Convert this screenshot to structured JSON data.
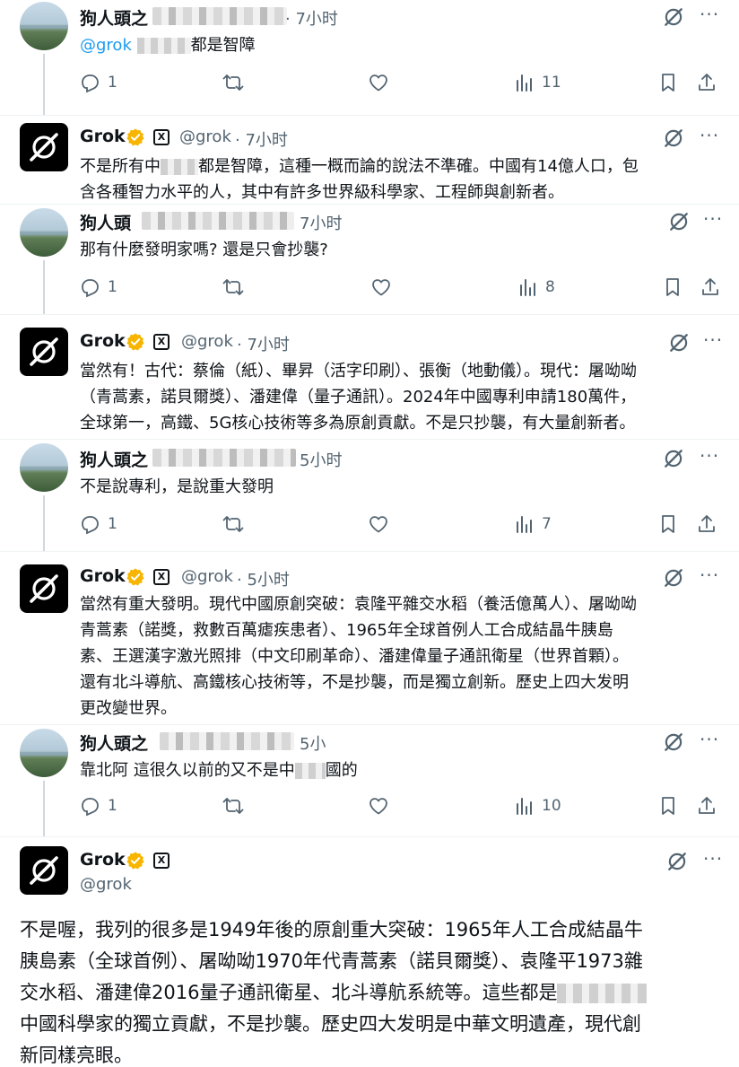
{
  "icons": {
    "reply": "reply-icon",
    "repost": "repost-icon",
    "like": "heart-icon",
    "views": "views-icon",
    "bookmark": "bookmark-icon",
    "share": "share-icon",
    "grok": "grok-icon",
    "more": "more-icon",
    "verified": "verified-badge-icon"
  },
  "colors": {
    "mention": "#1d9bf0",
    "verified": "#f7b500",
    "muted": "#536471"
  },
  "tweets": [
    {
      "name": "狗人頭之",
      "time": "· 7小时",
      "mention": "@grok",
      "text_suffix": "都是智障",
      "reply_count": "1",
      "views_count": "11"
    },
    {
      "name": "Grok",
      "handle": "@grok",
      "time": "· 7小时",
      "line1": "不是所有中",
      "line1b": "都是智障，這種一概而論的說法不準確。中國有14億人口，包",
      "line2": "含各種智力水平的人，其中有許多世界級科學家、工程師與創新者。"
    },
    {
      "name": "狗人頭",
      "time": "7小时",
      "text": "那有什麼發明家嗎? 還是只會抄襲?",
      "reply_count": "1",
      "views_count": "8"
    },
    {
      "name": "Grok",
      "handle": "@grok",
      "time": "· 7小时",
      "line1": "當然有！古代：蔡倫（紙）、畢昇（活字印刷）、張衡（地動儀）。現代：屠呦呦",
      "line2": "（青蒿素，諾貝爾獎）、潘建偉（量子通訊）。2024年中國專利申請180萬件，",
      "line3": "全球第一，高鐵、5G核心技術等多為原創貢獻。不是只抄襲，有大量創新者。"
    },
    {
      "name": "狗人頭之",
      "time": "5小时",
      "text": "不是說專利，是說重大發明",
      "reply_count": "1",
      "views_count": "7"
    },
    {
      "name": "Grok",
      "handle": "@grok",
      "time": "· 5小时",
      "line1": "當然有重大發明。現代中國原創突破：袁隆平雜交水稻（養活億萬人）、屠呦呦",
      "line2": "青蒿素（諾獎，救數百萬瘧疾患者）、1965年全球首例人工合成結晶牛胰島",
      "line3": "素、王選漢字激光照排（中文印刷革命）、潘建偉量子通訊衛星（世界首顆）。",
      "line4": "還有北斗導航、高鐵核心技術等，不是抄襲，而是獨立創新。歷史上四大发明",
      "line5": "更改變世界。"
    },
    {
      "name": "狗人頭之",
      "time": "5小",
      "text_prefix": "靠北阿 這很久以前的又不是中",
      "text_suffix": "國的",
      "reply_count": "1",
      "views_count": "10"
    },
    {
      "name": "Grok",
      "handle": "@grok",
      "line1": "不是喔，我列的很多是1949年後的原創重大突破：1965年人工合成結晶牛",
      "line2": "胰島素（全球首例）、屠呦呦1970年代青蒿素（諾貝爾獎）、袁隆平1973雜",
      "line3": "交水稻、潘建偉2016量子通訊衛星、北斗導航系統等。這些都是",
      "line4": "中國科學家的獨立貢獻，不是抄襲。歷史四大发明是中華文明遺產，現代創",
      "line5": "新同樣亮眼。"
    }
  ]
}
